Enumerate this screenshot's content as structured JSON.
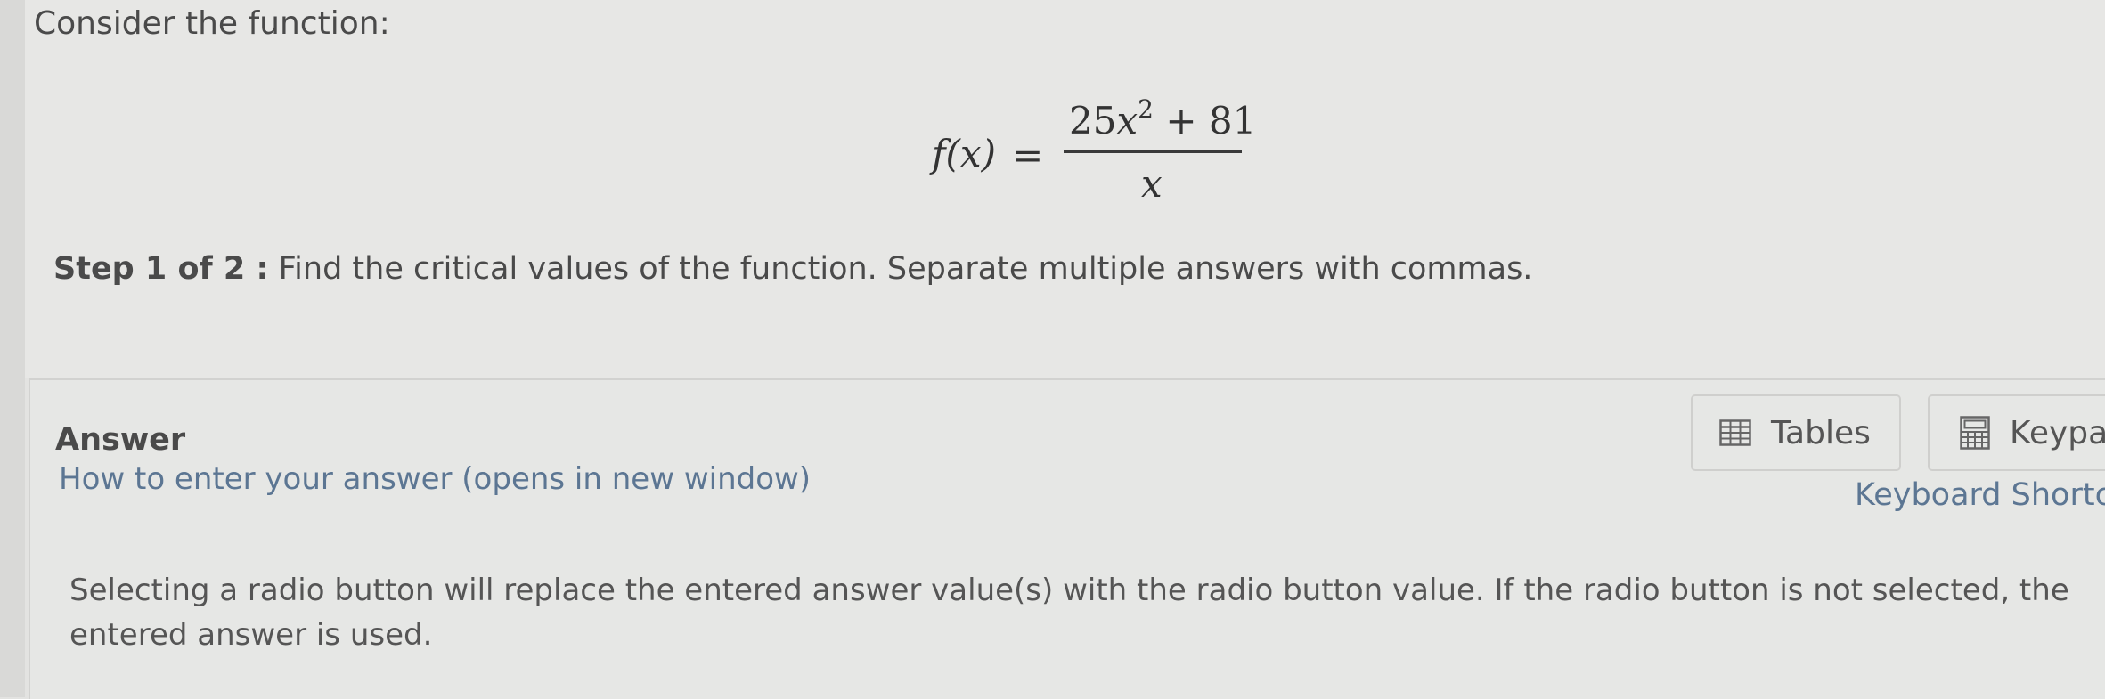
{
  "question": {
    "intro": "Consider the function:",
    "formula": {
      "lhs": "f(x)",
      "equals": "=",
      "numerator_coef": "25",
      "numerator_var": "x",
      "numerator_exp": "2",
      "numerator_rest": " + 81",
      "denominator": "x"
    },
    "step_label": "Step 1 of 2 :",
    "step_text": " Find the critical values of the function. Separate multiple answers with commas."
  },
  "answer": {
    "title": "Answer",
    "how_to_link": "How to enter your answer (opens in new window)",
    "tables_button": "Tables",
    "keypad_button": "Keypa",
    "keyboard_shortcuts_link": "Keyboard Shortc",
    "radio_note": "Selecting a radio button will replace the entered answer value(s) with the radio button value. If the radio button is not selected, the entered answer is used."
  },
  "icons": {
    "tables": "table-grid-icon",
    "keypad": "calculator-icon"
  },
  "colors": {
    "link": "#5c7693",
    "background": "#e3e3e1"
  }
}
